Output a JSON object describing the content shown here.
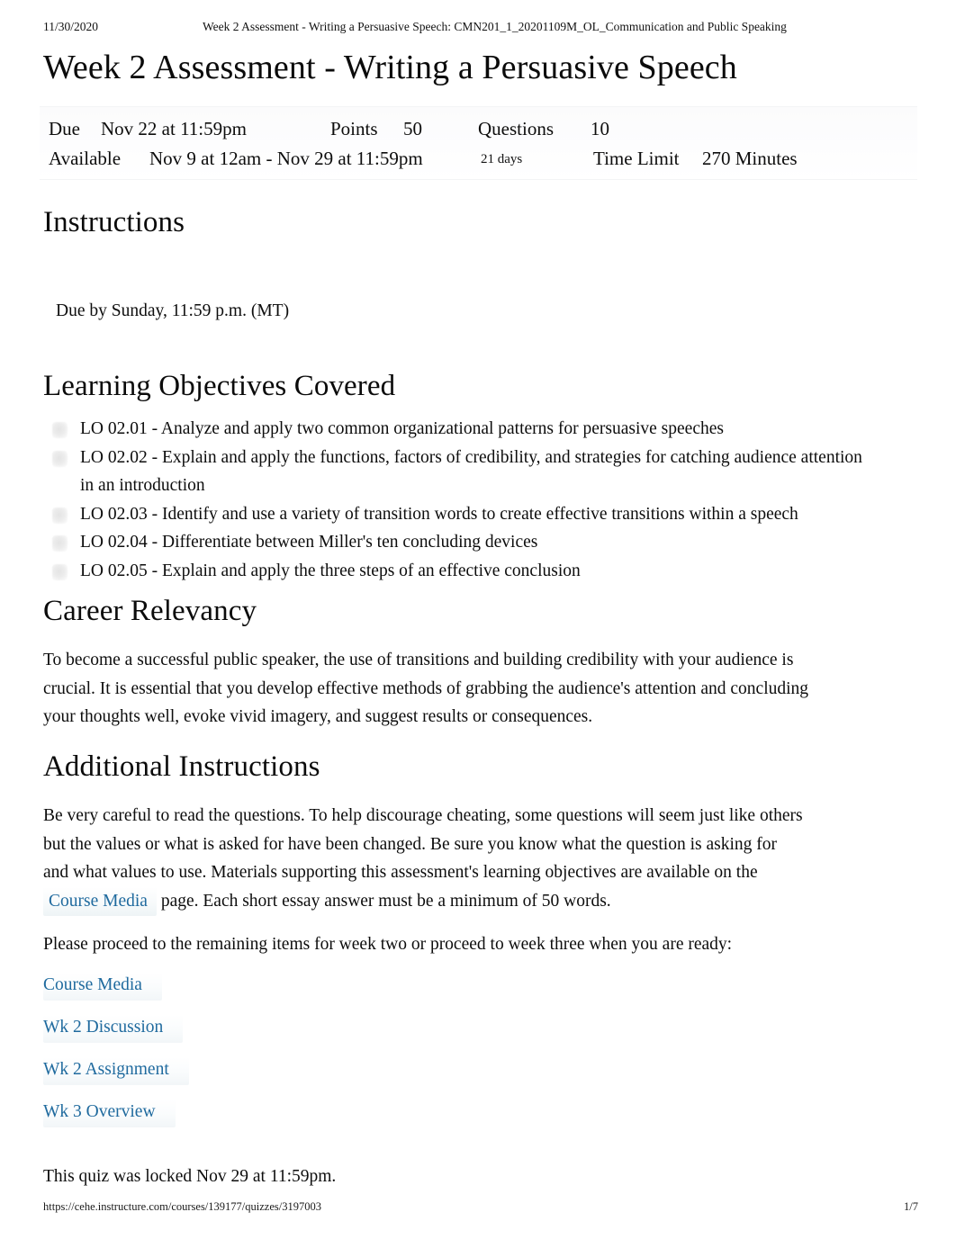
{
  "print_header": {
    "date": "11/30/2020",
    "title": "Week 2 Assessment - Writing a Persuasive Speech: CMN201_1_20201109M_OL_Communication and Public Speaking"
  },
  "doc_title": "Week 2 Assessment - Writing a Persuasive Speech",
  "meta": {
    "due_label": "Due",
    "due_value": "Nov 22 at 11:59pm",
    "points_label": "Points",
    "points_value": "50",
    "questions_label": "Questions",
    "questions_value": "10",
    "available_label": "Available",
    "available_value": "Nov 9 at 12am - Nov 29 at 11:59pm",
    "duration_days": "21 days",
    "time_limit_label": "Time Limit",
    "time_limit_value": "270 Minutes"
  },
  "sections": {
    "instructions_heading": "Instructions",
    "due_note": "Due by Sunday, 11:59 p.m. (MT)",
    "lo_heading": "Learning Objectives Covered",
    "lo_items": [
      "LO 02.01 - Analyze and apply two common organizational patterns for persuasive speeches",
      "LO 02.02 - Explain and apply the functions, factors of credibility, and strategies for catching audience attention in an introduction",
      "LO 02.03 - Identify and use a variety of transition words to create effective transitions within a speech",
      "LO 02.04 - Differentiate between Miller's ten concluding devices",
      "LO 02.05 - Explain and apply the three steps of an effective conclusion"
    ],
    "career_heading": "Career Relevancy",
    "career_text": "To become a successful public speaker, the use of transitions and building credibility with your audience is crucial. It is essential that you develop effective methods of grabbing the audience's attention and concluding your thoughts well, evoke vivid imagery, and suggest results or consequences.",
    "additional_heading": "Additional Instructions",
    "additional_text_before_link": "Be very careful to read the questions. To help discourage cheating, some questions will seem just like others but the values or what is asked for have been changed. Be sure you know what the question is asking for and what values to use. Materials supporting this assessment's learning objectives are available on the",
    "additional_inline_link": "Course Media",
    "additional_text_after_link": "page.   Each short essay answer must be a minimum of 50 words.",
    "proceed_text": "Please proceed to the remaining items for week two or proceed to week three when you are ready:",
    "resource_links": [
      "Course Media",
      "Wk 2 Discussion",
      "Wk 2 Assignment",
      "Wk 3 Overview"
    ],
    "locked_note": "This quiz was locked Nov 29 at 11:59pm."
  },
  "print_footer": {
    "url": "https://cehe.instructure.com/courses/139177/quizzes/3197003",
    "page": "1/7"
  },
  "colors": {
    "link": "#1f6a9e",
    "text": "#0d0d0d",
    "meta_background": "#fbfbfc"
  }
}
